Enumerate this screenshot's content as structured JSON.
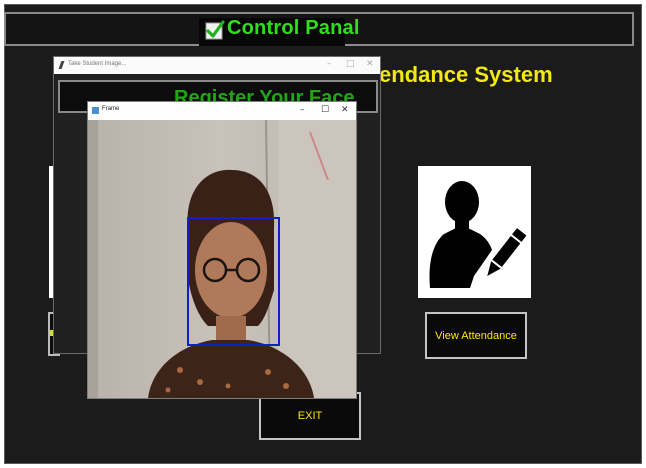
{
  "main_window": {
    "title": "Control Panal",
    "heading_visible": "endance System",
    "view_attendance_label": "View Attendance",
    "exit_label": "EXIT"
  },
  "take_image_window": {
    "title": "Take Student Image...",
    "controls": {
      "minimize": "–",
      "maximize": "□",
      "close": "✕"
    },
    "register_heading": "Register Your Face"
  },
  "frame_window": {
    "title": "Frame",
    "controls": {
      "minimize": "–",
      "maximize": "☐",
      "close": "✕"
    }
  },
  "icons": [
    "check-icon",
    "user-edit-icon",
    "pen-icon",
    "feather-icon",
    "frame-app-icon"
  ],
  "colors": {
    "background": "#1b1b1b",
    "title_green": "#2ee01a",
    "heading_yellow": "#f3e813",
    "button_text": "#ffe600",
    "register_green": "#22a515",
    "face_box": "#1020c8"
  }
}
